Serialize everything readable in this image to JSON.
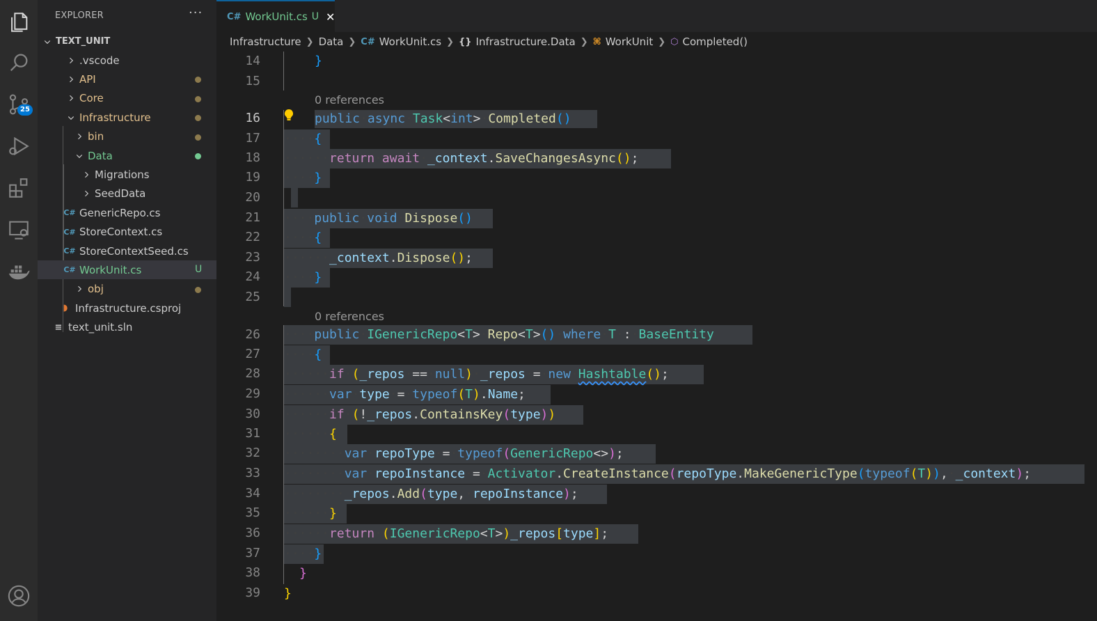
{
  "activity_bar": {
    "items": [
      {
        "name": "explorer-icon"
      },
      {
        "name": "search-icon"
      },
      {
        "name": "source-control-icon",
        "badge": "25"
      },
      {
        "name": "run-debug-icon"
      },
      {
        "name": "extensions-icon"
      },
      {
        "name": "remote-explorer-icon"
      },
      {
        "name": "docker-icon"
      },
      {
        "name": "account-icon"
      }
    ],
    "colors": {
      "badge": "#0078d4",
      "bar": "#2c2c2c"
    }
  },
  "sidebar": {
    "title": "EXPLORER",
    "more": "···",
    "root": "TEXT_UNIT",
    "items": [
      {
        "label": ".vscode",
        "kind": "folder",
        "open": false,
        "color": "#cccccc",
        "badge": ""
      },
      {
        "label": "API",
        "kind": "folder",
        "open": false,
        "color": "#e2c08d",
        "badge": "dot"
      },
      {
        "label": "Core",
        "kind": "folder",
        "open": false,
        "color": "#e2c08d",
        "badge": "dot"
      },
      {
        "label": "Infrastructure",
        "kind": "folder",
        "open": true,
        "color": "#e2c08d",
        "badge": "dot"
      },
      {
        "label": "bin",
        "kind": "folder",
        "open": false,
        "color": "#e2c08d",
        "badge": "dot"
      },
      {
        "label": "Data",
        "kind": "folder",
        "open": true,
        "color": "#73c991",
        "badge": "dot"
      },
      {
        "label": "Migrations",
        "kind": "folder",
        "open": false,
        "color": "#cccccc",
        "badge": ""
      },
      {
        "label": "SeedData",
        "kind": "folder",
        "open": false,
        "color": "#cccccc",
        "badge": ""
      },
      {
        "label": "GenericRepo.cs",
        "kind": "cs",
        "color": "#cccccc",
        "badge": ""
      },
      {
        "label": "StoreContext.cs",
        "kind": "cs",
        "color": "#cccccc",
        "badge": ""
      },
      {
        "label": "StoreContextSeed.cs",
        "kind": "cs",
        "color": "#cccccc",
        "badge": ""
      },
      {
        "label": "WorkUnit.cs",
        "kind": "cs",
        "color": "#73c991",
        "badge": "U",
        "selected": true
      },
      {
        "label": "obj",
        "kind": "folder",
        "open": false,
        "color": "#e2c08d",
        "badge": "dot"
      },
      {
        "label": "Infrastructure.csproj",
        "kind": "rss",
        "color": "#cccccc",
        "badge": ""
      },
      {
        "label": "text_unit.sln",
        "kind": "sln",
        "color": "#cccccc",
        "badge": ""
      }
    ]
  },
  "tab": {
    "label": "WorkUnit.cs",
    "status": "U",
    "close": "✕"
  },
  "breadcrumbs": {
    "items": [
      "Infrastructure",
      "Data",
      "WorkUnit.cs",
      "Infrastructure.Data",
      "WorkUnit",
      "Completed()"
    ]
  },
  "editor": {
    "codelens": [
      "0 references",
      "0 references"
    ],
    "line_numbers": [
      "14",
      "15",
      "16",
      "17",
      "18",
      "19",
      "20",
      "21",
      "22",
      "23",
      "24",
      "25",
      "26",
      "27",
      "28",
      "29",
      "30",
      "31",
      "32",
      "33",
      "34",
      "35",
      "36",
      "37",
      "38",
      "39"
    ],
    "current_line": "16"
  }
}
